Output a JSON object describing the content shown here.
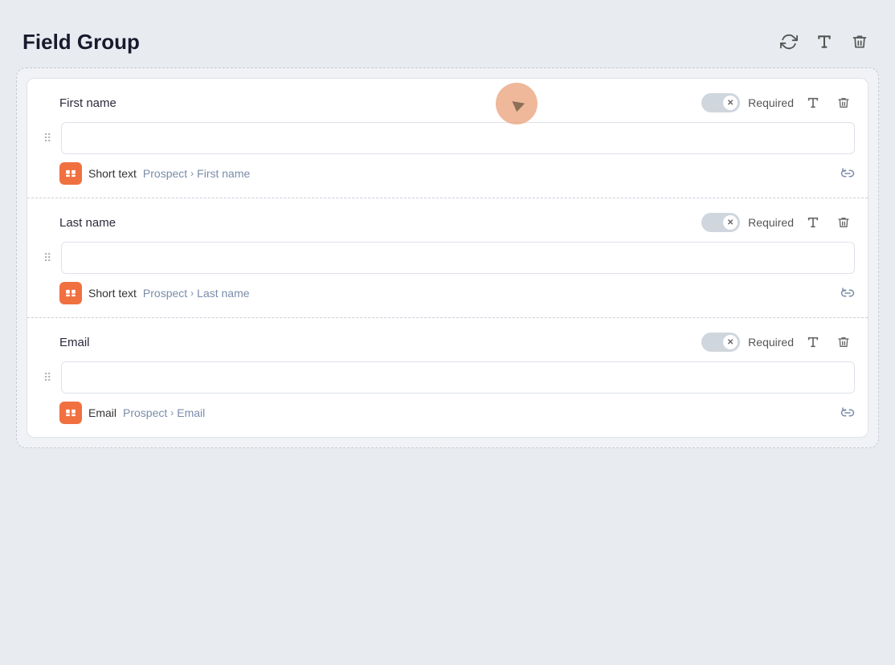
{
  "header": {
    "title": "Field Group",
    "actions": {
      "refresh_label": "↻",
      "type_label": "T",
      "delete_label": "🗑"
    }
  },
  "fields": [
    {
      "id": "first-name",
      "label": "First name",
      "required_text": "Required",
      "type_label": "Short text",
      "path_entity": "Prospect",
      "path_field": "First name",
      "input_placeholder": ""
    },
    {
      "id": "last-name",
      "label": "Last name",
      "required_text": "Required",
      "type_label": "Short text",
      "path_entity": "Prospect",
      "path_field": "Last name",
      "input_placeholder": ""
    },
    {
      "id": "email",
      "label": "Email",
      "required_text": "Required",
      "type_label": "Email",
      "path_entity": "Prospect",
      "path_field": "Email",
      "input_placeholder": ""
    }
  ]
}
